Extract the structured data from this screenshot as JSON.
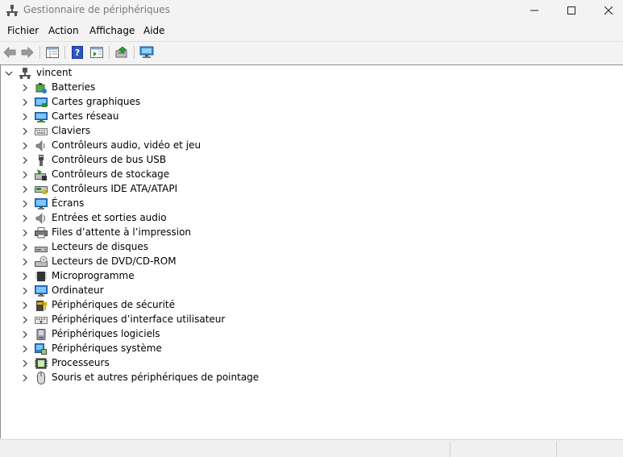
{
  "window": {
    "title": "Gestionnaire de périphériques",
    "controls": [
      "minimize-icon",
      "maximize-icon",
      "close-icon"
    ]
  },
  "menu": {
    "items": [
      "Fichier",
      "Action",
      "Affichage",
      "Aide"
    ]
  },
  "toolbar": {
    "buttons": [
      "back-arrow-icon",
      "forward-arrow-icon",
      "properties-view-icon",
      "help-icon",
      "details-pane-icon",
      "update-driver-icon",
      "scan-monitor-icon"
    ]
  },
  "tree": {
    "root": {
      "label": "vincent",
      "icon": "computer-icon"
    },
    "items": [
      {
        "label": "Batteries",
        "icon": "battery-icon"
      },
      {
        "label": "Cartes graphiques",
        "icon": "display-adapter-icon"
      },
      {
        "label": "Cartes réseau",
        "icon": "network-adapter-icon"
      },
      {
        "label": "Claviers",
        "icon": "keyboard-icon"
      },
      {
        "label": "Contrôleurs audio, vidéo et jeu",
        "icon": "speaker-icon"
      },
      {
        "label": "Contrôleurs de bus USB",
        "icon": "usb-icon"
      },
      {
        "label": "Contrôleurs de stockage",
        "icon": "storage-controller-icon"
      },
      {
        "label": "Contrôleurs IDE ATA/ATAPI",
        "icon": "ide-controller-icon"
      },
      {
        "label": "Écrans",
        "icon": "monitor-icon"
      },
      {
        "label": "Entrées et sorties audio",
        "icon": "audio-io-icon"
      },
      {
        "label": "Files d’attente à l’impression",
        "icon": "printer-icon"
      },
      {
        "label": "Lecteurs de disques",
        "icon": "disk-drive-icon"
      },
      {
        "label": "Lecteurs de DVD/CD-ROM",
        "icon": "dvd-drive-icon"
      },
      {
        "label": "Microprogramme",
        "icon": "firmware-chip-icon"
      },
      {
        "label": "Ordinateur",
        "icon": "computer-monitor-icon"
      },
      {
        "label": "Périphériques de sécurité",
        "icon": "security-device-icon"
      },
      {
        "label": "Périphériques d’interface utilisateur",
        "icon": "hid-icon"
      },
      {
        "label": "Périphériques logiciels",
        "icon": "software-device-icon"
      },
      {
        "label": "Périphériques système",
        "icon": "system-device-icon"
      },
      {
        "label": "Processeurs",
        "icon": "processor-icon"
      },
      {
        "label": "Souris et autres périphériques de pointage",
        "icon": "mouse-icon"
      }
    ]
  }
}
